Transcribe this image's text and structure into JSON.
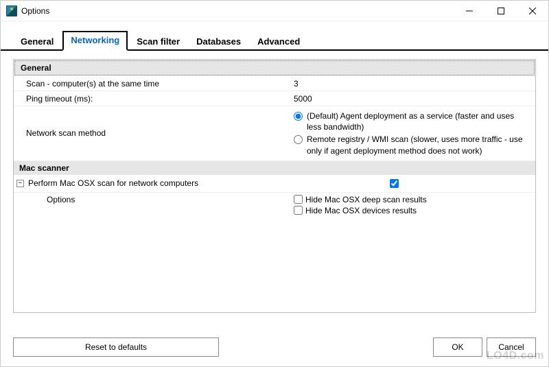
{
  "window": {
    "title": "Options"
  },
  "tabs": {
    "general": "General",
    "networking": "Networking",
    "scan_filter": "Scan filter",
    "databases": "Databases",
    "advanced": "Advanced",
    "active": "networking"
  },
  "section_general": {
    "title": "General",
    "scan_concurrent_label": "Scan - computer(s) at the same time",
    "scan_concurrent_value": "3",
    "ping_timeout_label": "Ping timeout (ms):",
    "ping_timeout_value": "5000",
    "scan_method_label": "Network scan method",
    "radio_default": "(Default) Agent deployment as a service (faster and uses less bandwidth)",
    "radio_remote": "Remote registry / WMI scan (slower, uses more traffic - use only if agent deployment method does not work)"
  },
  "section_mac": {
    "title": "Mac scanner",
    "perform_label": "Perform Mac OSX scan for network computers",
    "perform_checked": true,
    "options_label": "Options",
    "hide_deep_label": "Hide Mac OSX deep scan results",
    "hide_deep_checked": false,
    "hide_devices_label": "Hide Mac OSX devices results",
    "hide_devices_checked": false,
    "tree_toggle": "−"
  },
  "buttons": {
    "reset": "Reset to defaults",
    "ok": "OK",
    "cancel": "Cancel"
  },
  "watermark": "LO4D.com"
}
